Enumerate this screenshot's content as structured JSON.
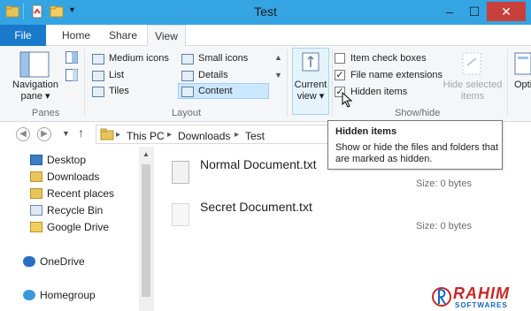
{
  "window": {
    "title": "Test",
    "minimize_glyph": "–",
    "maximize_glyph": "☐",
    "close_glyph": "✕"
  },
  "tabs": [
    "File",
    "Home",
    "Share",
    "View"
  ],
  "ribbon": {
    "panes_group": {
      "label": "Panes",
      "navigation_pane": "Navigation pane ▾"
    },
    "layout_group": {
      "label": "Layout",
      "items": [
        "Medium icons",
        "List",
        "Tiles",
        "Small icons",
        "Details",
        "Content"
      ],
      "selected": "Content"
    },
    "current_view": "Current view ▾",
    "showhide_group": {
      "label": "Show/hide",
      "item_check_boxes": "Item check boxes",
      "file_name_extensions": "File name extensions",
      "hidden_items": "Hidden items",
      "hide_selected_items": "Hide selected items",
      "item_check_boxes_checked": false,
      "file_name_extensions_checked": true,
      "hidden_items_checked": true
    },
    "options_partial": "Opti"
  },
  "address": {
    "crumbs": [
      "This PC",
      "Downloads",
      "Test"
    ]
  },
  "tooltip": {
    "title": "Hidden items",
    "body": "Show or hide the files and folders that are marked as hidden."
  },
  "nav_items": [
    "Desktop",
    "Downloads",
    "Recent places",
    "Recycle Bin",
    "Google Drive",
    "OneDrive",
    "Homegroup"
  ],
  "files": [
    {
      "name": "Normal Document.txt",
      "size": "Size: 0 bytes"
    },
    {
      "name": "Secret Document.txt",
      "size": "Size: 0 bytes"
    }
  ],
  "watermark": {
    "main": "RAHIM",
    "sub": "SOFTWARES"
  },
  "colors": {
    "title_bar": "#34a4e3",
    "file_tab": "#1979ca",
    "close_button": "#c7413a",
    "selection": "#cce8ff",
    "watermark_red": "#c62828",
    "watermark_blue": "#1565c0"
  }
}
